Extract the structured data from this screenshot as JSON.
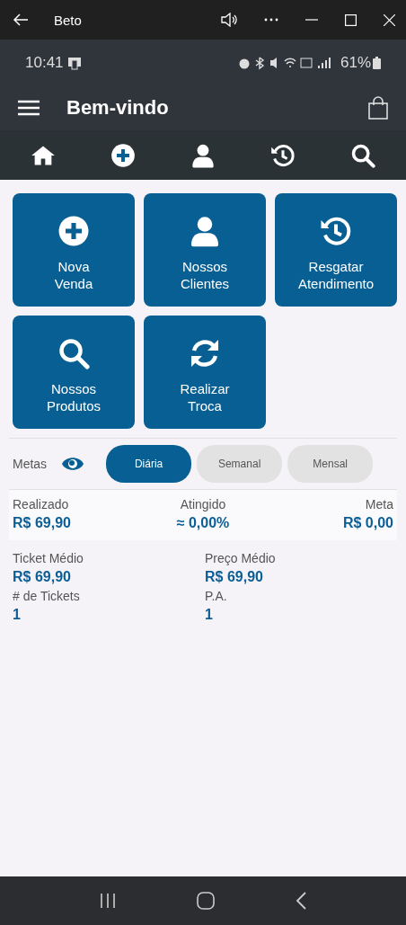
{
  "window": {
    "title": "Beto"
  },
  "status_bar": {
    "time": "10:41",
    "battery": "61%"
  },
  "app_bar": {
    "title": "Bem-vindo"
  },
  "toolbar": [
    {
      "kind": "home"
    },
    {
      "kind": "plus"
    },
    {
      "kind": "person"
    },
    {
      "kind": "history"
    },
    {
      "kind": "search"
    }
  ],
  "tiles": [
    {
      "kind": "plus",
      "label": "Nova\nVenda"
    },
    {
      "kind": "person",
      "label": "Nossos\nClientes"
    },
    {
      "kind": "history",
      "label": "Resgatar\nAtendimento"
    },
    {
      "kind": "search",
      "label": "Nossos\nProdutos"
    },
    {
      "kind": "refresh",
      "label": "Realizar\nTroca"
    }
  ],
  "goals": {
    "label": "Metas",
    "periods": [
      {
        "label": "Diária",
        "selected": true
      },
      {
        "label": "Semanal",
        "selected": false
      },
      {
        "label": "Mensal",
        "selected": false
      }
    ]
  },
  "summary": [
    {
      "label": "Realizado",
      "value": "R$ 69,90"
    },
    {
      "label": "Atingido",
      "value": "≈ 0,00%"
    },
    {
      "label": "Meta",
      "value": "R$ 0,00"
    }
  ],
  "stats": [
    {
      "label": "Ticket Médio",
      "value": "R$ 69,90"
    },
    {
      "label": "Preço Médio",
      "value": "R$ 69,90"
    },
    {
      "label": "# de Tickets",
      "value": "1"
    },
    {
      "label": "P.A.",
      "value": "1"
    }
  ]
}
